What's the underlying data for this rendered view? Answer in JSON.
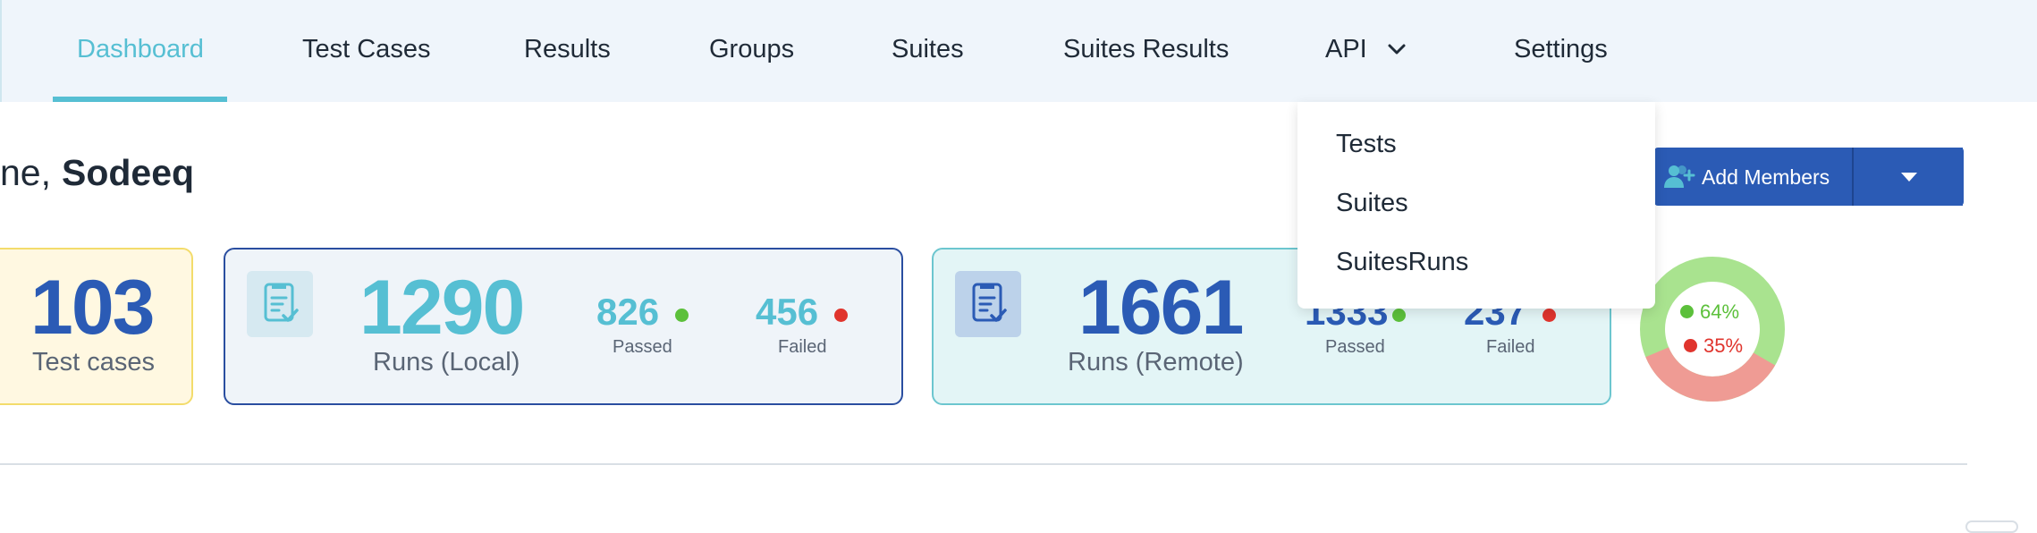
{
  "nav": {
    "items": [
      "Dashboard",
      "Test Cases",
      "Results",
      "Groups",
      "Suites",
      "Suites Results",
      "API",
      "Settings"
    ],
    "active": "Dashboard"
  },
  "dropdown": {
    "items": [
      "Tests",
      "Suites",
      "SuitesRuns"
    ]
  },
  "greeting": {
    "prefix": "ne,",
    "name": "Sodeeq"
  },
  "cards": {
    "tests": {
      "value": "103",
      "label": "Test cases"
    },
    "local": {
      "value": "1290",
      "label": "Runs (Local)",
      "passed": "826",
      "passed_label": "Passed",
      "failed": "456",
      "failed_label": "Failed"
    },
    "remote": {
      "value": "1661",
      "label": "Runs (Remote)",
      "passed": "1333",
      "passed_label": "Passed",
      "failed": "237",
      "failed_label": "Failed"
    }
  },
  "add_members": {
    "label": "Add Members"
  },
  "donut": {
    "passed_pct": "64%",
    "failed_pct": "35%",
    "passed_value": 64,
    "failed_value": 35
  },
  "colors": {
    "accent": "#56bfd3",
    "brand": "#2b5bb5",
    "pass": "#5cc03b",
    "fail": "#e0342d",
    "donut_pass": "#a9e38f",
    "donut_fail": "#ef9b94"
  },
  "icons": [
    "chevron-down-icon",
    "document-check-icon",
    "add-user-icon",
    "caret-down-icon"
  ]
}
